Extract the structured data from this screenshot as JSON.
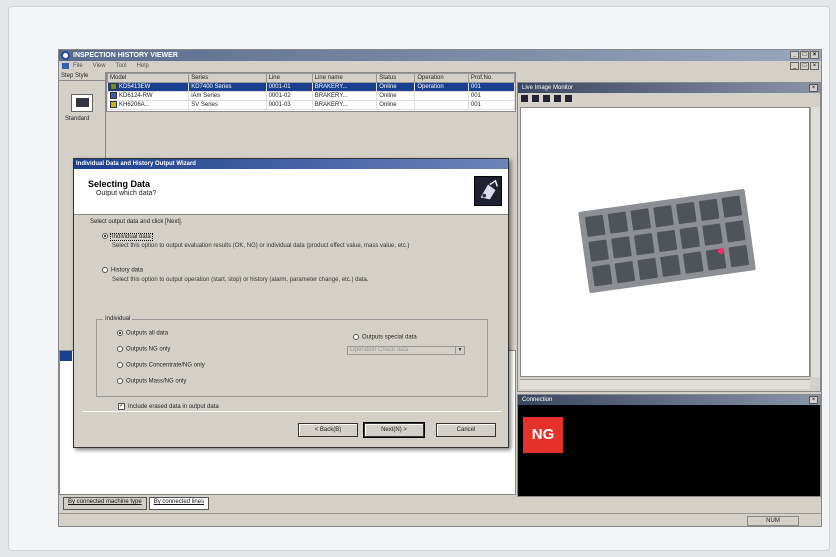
{
  "window": {
    "title": "INSPECTION HISTORY VIEWER",
    "menu": [
      "File",
      "View",
      "Tool",
      "Help"
    ]
  },
  "step_panel": {
    "header": "Step Style",
    "label": "Standard"
  },
  "machine_table": {
    "columns": [
      "Model",
      "Series",
      "Line",
      "Line name",
      "Status",
      "Operation",
      "Prof.No."
    ],
    "rows": [
      [
        "KD5413EW",
        "KD7400 Series",
        "0001-01",
        "BRAKERY...",
        "Online",
        "Operation",
        "001"
      ],
      [
        "KD6124-RW",
        "iAm Series",
        "0001-02",
        "BRAKERY...",
        "Online",
        "",
        "001"
      ],
      [
        "KH6206A...",
        "SV Series",
        "0001-03",
        "BRAKERY...",
        "Online",
        "",
        "001"
      ]
    ]
  },
  "image_monitor": {
    "title": "Live Image Monitor"
  },
  "connection": {
    "title": "Connection",
    "result": "NG"
  },
  "tabs": [
    "By connected machine type",
    "By connected lines"
  ],
  "status": {
    "num": "NUM"
  },
  "wizard": {
    "title": "Individual Data and History Output Wizard",
    "heading": "Selecting Data",
    "subheading": "Output which data?",
    "prompt": "Select output data and click [Next].",
    "option1": "Individual data",
    "option1_desc": "Select this option to output evaluation results (OK, NG) or individual data (product effect value, mass value, etc.)",
    "option2": "History data",
    "option2_desc": "Select this option to output operation (start, stop) or history (alarm, parameter change, etc.) data.",
    "group_label": "Individual",
    "sub_all": "Outputs all data",
    "sub_ng": "Outputs NG only",
    "sub_cont": "Outputs Concentrate/NG only",
    "sub_mass": "Outputs Mass/NG only",
    "sub_special": "Outputs special data",
    "select_value": "Operation Check data",
    "checkbox": "Include erased data in output data",
    "btn_back": "< Back(B)",
    "btn_next": "Next(N) >",
    "btn_cancel": "Cancel"
  }
}
